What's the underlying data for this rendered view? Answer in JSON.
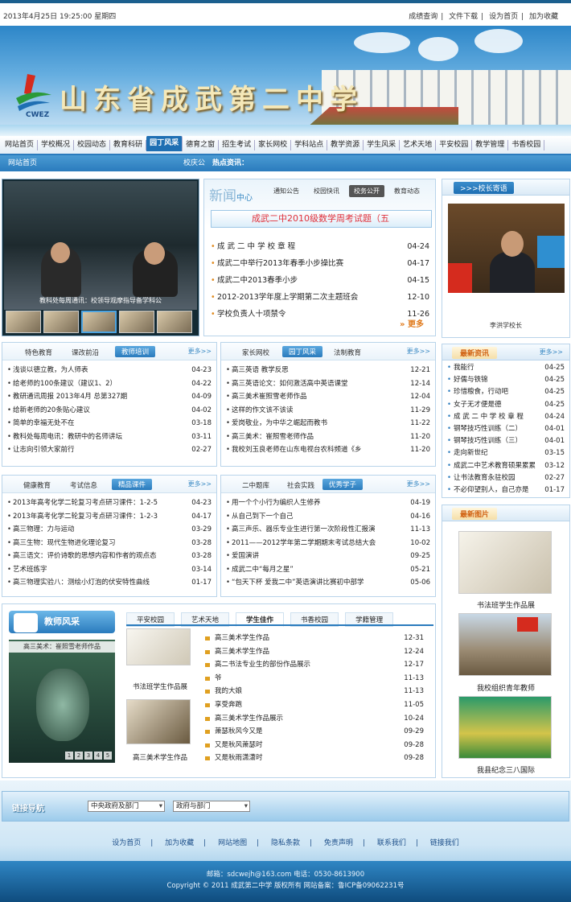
{
  "topbar": {
    "date": "2013年4月25日  19:25:00  星期四",
    "links": [
      "成绩查询",
      "文件下载",
      "设为首页",
      "加为收藏"
    ]
  },
  "banner": {
    "title": "山东省成武第二中学",
    "logo_text": "CWEZ"
  },
  "nav": [
    "网站首页",
    "学校概况",
    "校园动态",
    "教育科研",
    "园丁风采",
    "德育之窗",
    "招生考试",
    "家长网校",
    "学科站点",
    "教学资源",
    "学生风采",
    "艺术天地",
    "平安校园",
    "教学管理",
    "书香校园"
  ],
  "sub": {
    "home": "网站首页",
    "k": "校庆公",
    "hot": "热点资讯："
  },
  "slide": {
    "caption": "教科处每周通讯：校领导观摩指导备学科公"
  },
  "news": {
    "big": "新闻",
    "center": "中心",
    "tabs": [
      "通知公告",
      "校园快讯",
      "校务公开",
      "教育动态"
    ],
    "headline": "成武二中2010级数学周考试题（五",
    "items": [
      [
        "成 武 二 中 学 校 章 程",
        "04-24"
      ],
      [
        "成武二中举行2013年春季小步操比赛",
        "04-17"
      ],
      [
        "成武二中2013春季小步",
        "04-15"
      ],
      [
        "2012-2013学年度上学期第二次主题班会",
        "12-10"
      ],
      [
        "学校负责人十项禁令",
        "11-26"
      ]
    ],
    "more": "更多"
  },
  "principal": {
    "title": ">>>校长寄语",
    "caption": "李洪学校长"
  },
  "box1": {
    "tabs": [
      "特色教育",
      "课改前沿",
      "教师培训"
    ],
    "more": "更多>>",
    "items": [
      [
        "浅谈以德立教，为人师表",
        "04-23"
      ],
      [
        "给老师的100条建议（建议1、2）",
        "04-22"
      ],
      [
        "教研通讯周报 2013年4月 总第327期",
        "04-09"
      ],
      [
        "给新老师的20条贴心建议",
        "04-02"
      ],
      [
        "简单的幸福无处不在",
        "03-18"
      ],
      [
        "教科处每周电讯：教研中的名师讲坛",
        "03-11"
      ],
      [
        "让志向引领大家前行",
        "02-27"
      ]
    ]
  },
  "box2": {
    "tabs": [
      "家长网校",
      "园丁风采",
      "法制教育"
    ],
    "more": "更多>>",
    "items": [
      [
        "高三英语 教学反思",
        "12-21"
      ],
      [
        "高三英语论文：如何激活高中英语课堂",
        "12-14"
      ],
      [
        "高三美术崔照雪老师作品",
        "12-04"
      ],
      [
        "这样的作文该不该读",
        "11-29"
      ],
      [
        "爱岗敬业，为中华之崛起而教书",
        "11-22"
      ],
      [
        "高三美术：崔照雪老师作品",
        "11-20"
      ],
      [
        "我校刘玉良老师在山东电视台农科频道《乡",
        "11-20"
      ]
    ]
  },
  "box3": {
    "tabs": [
      "健康教育",
      "考试信息",
      "精品课件"
    ],
    "more": "更多>>",
    "items": [
      [
        "2013年高考化学二轮复习考点研习课件：1-2-5",
        "04-23"
      ],
      [
        "2013年高考化学二轮复习考点研习课件：1-2-3",
        "04-17"
      ],
      [
        "高三物理：力与运动",
        "03-29"
      ],
      [
        "高三生物：现代生物进化理论复习",
        "03-28"
      ],
      [
        "高三语文：评价诗歌的思想内容和作者的观点态",
        "03-28"
      ],
      [
        "艺术班练字",
        "03-14"
      ],
      [
        "高三物理实验八：测绘小灯泡的伏安特性曲线",
        "01-17"
      ]
    ]
  },
  "box4": {
    "tabs": [
      "二中题库",
      "社会实践",
      "优秀学子"
    ],
    "more": "更多>>",
    "items": [
      [
        "用一个个小行为编织人生修养",
        "04-19"
      ],
      [
        "从自己到下一个自己",
        "04-16"
      ],
      [
        "高三声乐、器乐专业生进行第一次阶段性汇报演",
        "11-13"
      ],
      [
        "2011——2012学年第二学期期末考试总结大会",
        "10-02"
      ],
      [
        "爱国演讲",
        "09-25"
      ],
      [
        "成武二中“每月之星”",
        "05-21"
      ],
      [
        "“包天下杯 爱我二中”英语演讲比赛初中部学",
        "05-06"
      ]
    ]
  },
  "latest": {
    "title": "最新资讯",
    "more": "更多>>",
    "items": [
      [
        "我能行",
        "04-25"
      ],
      [
        "好儒与铁锦",
        "04-25"
      ],
      [
        "珍惜粮食，行动吧",
        "04-25"
      ],
      [
        "女子无才便是德",
        "04-25"
      ],
      [
        "成 武 二 中 学 校 章 程",
        "04-24"
      ],
      [
        "钢琴技巧性训练（二）",
        "04-01"
      ],
      [
        "钢琴技巧性训练（三）",
        "04-01"
      ],
      [
        "走向新世纪",
        "03-15"
      ],
      [
        "成武二中艺术教育硕果累累",
        "03-12"
      ],
      [
        "让书法教育永驻校园",
        "02-27"
      ],
      [
        "不必仰望别人，自己亦是",
        "01-17"
      ]
    ]
  },
  "pics": {
    "title": "最新图片",
    "captions": [
      "书法班学生作品展",
      "我校组织青年教师",
      "我县纪念三八国际"
    ]
  },
  "teacher": {
    "title": "教师风采",
    "pic_title": "高三美术：崔照雪老师作品",
    "dots": [
      "1",
      "2",
      "3",
      "4",
      "5"
    ],
    "tabs": [
      "平安校园",
      "艺术天地",
      "学生佳作",
      "书香校园",
      "学籍管理"
    ],
    "thumb_caps": [
      "书法班学生作品展",
      "高三美术学生作品"
    ],
    "items": [
      [
        "高三美术学生作品",
        "12-31"
      ],
      [
        "高三美术学生作品",
        "12-24"
      ],
      [
        "高二书法专业生的部份作品展示",
        "12-17"
      ],
      [
        "爷",
        "11-13"
      ],
      [
        "我的大娘",
        "11-13"
      ],
      [
        "享受奔跑",
        "11-05"
      ],
      [
        "高三美术学生作品展示",
        "10-24"
      ],
      [
        "萧瑟秋风今又是",
        "09-29"
      ],
      [
        "又是秋风萧瑟时",
        "09-28"
      ],
      [
        "又是秋雨潇潇时",
        "09-28"
      ]
    ]
  },
  "links": {
    "title": "链接导航",
    "sel1": "中央政府及部门",
    "sel2": "政府与部门"
  },
  "footer": {
    "links": [
      "设为首页",
      "加为收藏",
      "网站地图",
      "隐私条款",
      "免责声明",
      "联系我们",
      "链接我们"
    ],
    "email": "邮箱：sdcwejh@163.com  电话：0530-8613900",
    "copyright": "Copyright © 2011  成武第二中学  版权所有  网站备案：鲁ICP备09062231号"
  },
  "colors": {
    "accent": "#2a7bbd",
    "headline": "#e0303a",
    "more": "#e07a1c"
  }
}
